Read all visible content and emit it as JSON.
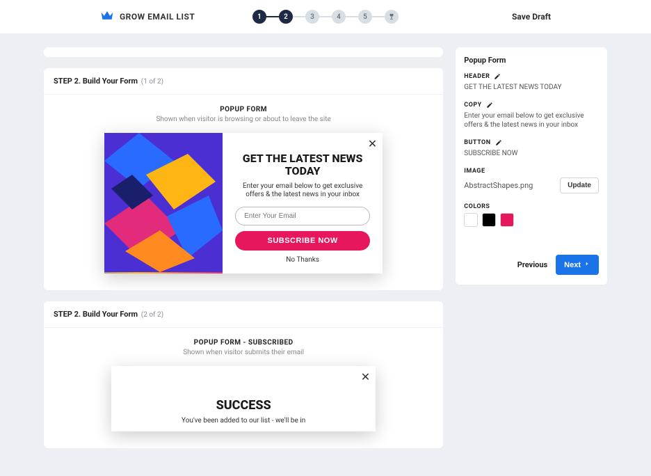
{
  "topbar": {
    "brand": "GROW EMAIL LIST",
    "save_draft": "Save Draft",
    "steps": [
      "1",
      "2",
      "3",
      "4",
      "5"
    ]
  },
  "step2a": {
    "header": "STEP 2. Build Your Form",
    "count": "(1 of 2)",
    "section_title": "POPUP FORM",
    "section_sub": "Shown when visitor is browsing or about to leave the site"
  },
  "popup": {
    "heading": "GET THE LATEST NEWS TODAY",
    "copy": "Enter your email below to get exclusive offers & the latest news in your inbox",
    "email_placeholder": "Enter Your Email",
    "button": "SUBSCRIBE NOW",
    "nothanks": "No Thanks"
  },
  "step2b": {
    "header": "STEP 2. Build Your Form",
    "count": "(2 of 2)",
    "section_title": "POPUP FORM - SUBSCRIBED",
    "section_sub": "Shown when visitor submits their email"
  },
  "popup2": {
    "heading": "SUCCESS",
    "copy": "You've been added to our list - we'll be in"
  },
  "panel": {
    "title": "Popup Form",
    "header_label": "HEADER",
    "header_value": "GET THE LATEST NEWS TODAY",
    "copy_label": "COPY",
    "copy_value": "Enter your email below to get exclusive offers & the latest news in your inbox",
    "button_label": "BUTTON",
    "button_value": "SUBSCRIBE NOW",
    "image_label": "IMAGE",
    "image_filename": "AbstractShapes.png",
    "update_label": "Update",
    "colors_label": "COLORS",
    "colors": [
      "#ffffff",
      "#000000",
      "#e6175c"
    ],
    "previous": "Previous",
    "next": "Next"
  }
}
